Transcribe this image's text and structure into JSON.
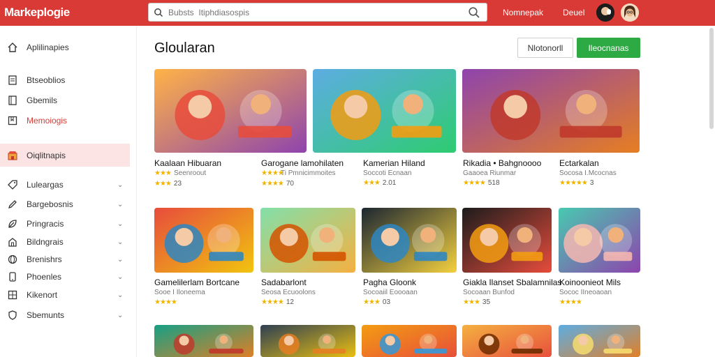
{
  "app": {
    "logo": "Markeplogie"
  },
  "search": {
    "placeholder": "Bubsts  Itiphdiasospis",
    "value": ""
  },
  "topnav": {
    "link1": "Nomnepak",
    "link2": "Deuel"
  },
  "sidebar": {
    "items": [
      {
        "label": "Aplilinapies",
        "icon": "home-icon"
      },
      {
        "label": "Btseoblios",
        "icon": "document-icon"
      },
      {
        "label": "Gbemils",
        "icon": "book-icon"
      },
      {
        "label": "Memoiogis",
        "icon": "bookmark-icon"
      },
      {
        "label": "Oiqlitnapis",
        "icon": "store-icon"
      },
      {
        "label": "Luleargas",
        "icon": "tag-icon"
      },
      {
        "label": "Bargebosnis",
        "icon": "pencil-icon"
      },
      {
        "label": "Pringracis",
        "icon": "leaf-icon"
      },
      {
        "label": "Bildngrais",
        "icon": "house-outline-icon"
      },
      {
        "label": "Brenishrs",
        "icon": "globe-icon"
      },
      {
        "label": "Phoenles",
        "icon": "phone-icon"
      },
      {
        "label": "Kikenort",
        "icon": "grid-icon"
      },
      {
        "label": "Sbemunts",
        "icon": "shield-icon"
      }
    ]
  },
  "main": {
    "title": "Gloularan",
    "btn_outline": "Nlotonorll",
    "btn_green": "Ileocnanas"
  },
  "cards": [
    {
      "name": "Kaalaan Hibuaran",
      "sub": "Seenroout",
      "rating": "23",
      "stars": "★★★",
      "theme": "t1"
    },
    {
      "name": "Garogane lamohilaten",
      "sub": "Ti Pmnicimmoites",
      "rating": "70",
      "stars": "★★★★",
      "theme": "t2"
    },
    {
      "name": "Kamerian Hiland",
      "sub": "Soccoti Ecnaan",
      "rating": "2.01",
      "stars": "★★★",
      "theme": "t3"
    },
    {
      "name": "Rikadia • Bahgnoooo",
      "sub": "Gaaoea Riunmar",
      "rating": "518",
      "stars": "★★★★",
      "theme": "t4"
    },
    {
      "name": "Ectarkalan",
      "sub": "Socosa I.Mcocnas",
      "rating": "3",
      "stars": "★★★★★",
      "theme": "t5"
    },
    {
      "name": "Gamelilerlam Bortcane",
      "sub": "Sooe I Iloneema",
      "rating": "",
      "stars": "★★★★",
      "theme": "t6"
    },
    {
      "name": "Sadabarlont",
      "sub": "Seosa Ecuoolons",
      "rating": "12",
      "stars": "★★★★",
      "theme": "t7"
    },
    {
      "name": "Pagha Gloonk",
      "sub": "Socoaiil Eoooaan",
      "rating": "03",
      "stars": "★★★",
      "theme": "t8"
    },
    {
      "name": "Giakla Ilanset Sbalamnilas",
      "sub": "Socoaan Bunfod",
      "rating": "35",
      "stars": "★★★",
      "theme": "t9"
    },
    {
      "name": "Koinoonieot Mils",
      "sub": "Sococ IIneoaoan",
      "rating": "",
      "stars": "★★★★",
      "theme": "t10"
    },
    {
      "name": "",
      "sub": "",
      "rating": "",
      "stars": "",
      "theme": "t11"
    },
    {
      "name": "",
      "sub": "",
      "rating": "",
      "stars": "",
      "theme": "t12"
    },
    {
      "name": "",
      "sub": "",
      "rating": "",
      "stars": "",
      "theme": "t13"
    },
    {
      "name": "",
      "sub": "",
      "rating": "",
      "stars": "",
      "theme": "t14"
    },
    {
      "name": "",
      "sub": "",
      "rating": "",
      "stars": "",
      "theme": "t15"
    }
  ],
  "colors": {
    "brand": "#d93a36",
    "accent_green": "#2eaa45",
    "active_bg": "#fbe4e3",
    "star": "#f0b400"
  }
}
